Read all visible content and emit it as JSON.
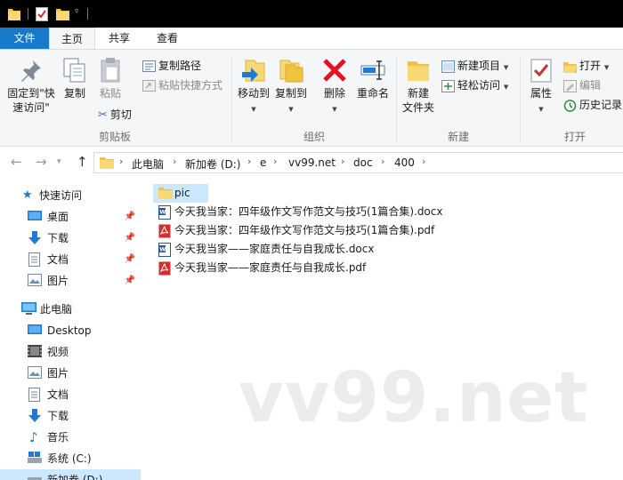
{
  "colors": {
    "accent": "#1979ca",
    "folder": "#f0c33c",
    "selection": "#cce8ff",
    "delete_red": "#e81123",
    "pdf_red": "#d32f2f",
    "word_blue": "#2b579a"
  },
  "ribbon_tabs": {
    "file": "文件",
    "home": "主页",
    "share": "共享",
    "view": "查看"
  },
  "ribbon": {
    "clipboard": {
      "pin_label": "固定到\"快速访问\"",
      "copy_label": "复制",
      "paste_label": "粘贴",
      "copy_path": "复制路径",
      "paste_shortcut": "粘贴快捷方式",
      "cut": "剪切",
      "group_label": "剪贴板"
    },
    "organize": {
      "move_to": "移动到",
      "copy_to": "复制到",
      "delete": "删除",
      "rename": "重命名",
      "group_label": "组织"
    },
    "new": {
      "new_folder": "新建\n文件夹",
      "new_item": "新建项目",
      "easy_access": "轻松访问",
      "group_label": "新建"
    },
    "open": {
      "properties": "属性",
      "open": "打开",
      "edit": "编辑",
      "history": "历史记录",
      "group_label": "打开"
    }
  },
  "address": {
    "crumbs": [
      "此电脑",
      "新加卷 (D:)",
      "e",
      "vv99.net",
      "doc",
      "400"
    ]
  },
  "nav": {
    "quick_access": "快速访问",
    "quick_items": [
      "桌面",
      "下载",
      "文档",
      "图片"
    ],
    "this_pc": "此电脑",
    "pc_items": [
      "Desktop",
      "视频",
      "图片",
      "文档",
      "下载",
      "音乐",
      "系统 (C:)",
      "新加卷 (D:)"
    ]
  },
  "files": [
    {
      "name": "pic",
      "type": "folder",
      "icon": "folder-icon"
    },
    {
      "name": "今天我当家：四年级作文写作范文与技巧(1篇合集).docx",
      "type": "docx",
      "icon": "word-doc-icon"
    },
    {
      "name": "今天我当家：四年级作文写作范文与技巧(1篇合集).pdf",
      "type": "pdf",
      "icon": "pdf-icon"
    },
    {
      "name": "今天我当家——家庭责任与自我成长.docx",
      "type": "docx",
      "icon": "word-doc-icon"
    },
    {
      "name": "今天我当家——家庭责任与自我成长.pdf",
      "type": "pdf",
      "icon": "pdf-icon"
    }
  ],
  "watermark": "vv99.net"
}
